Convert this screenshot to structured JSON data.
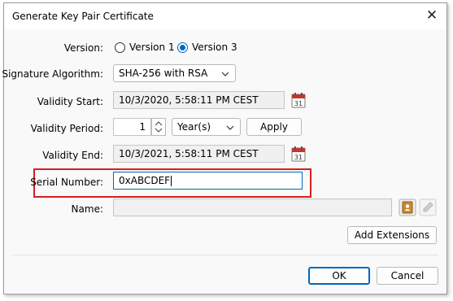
{
  "dialog": {
    "title": "Generate Key Pair Certificate",
    "close_icon": "close-icon"
  },
  "version": {
    "label": "Version:",
    "options": [
      "Version 1",
      "Version 3"
    ],
    "selected": "Version 3"
  },
  "signature": {
    "label": "Signature Algorithm:",
    "value": "SHA-256 with RSA"
  },
  "validity_start": {
    "label": "Validity Start:",
    "value": "10/3/2020, 5:58:11 PM CEST",
    "icon": "calendar-icon"
  },
  "validity_period": {
    "label": "Validity Period:",
    "value": "1",
    "unit": "Year(s)",
    "apply_label": "Apply"
  },
  "validity_end": {
    "label": "Validity End:",
    "value": "10/3/2021, 5:58:11 PM CEST",
    "icon": "calendar-icon"
  },
  "serial": {
    "label": "Serial Number:",
    "value": "0xABCDEF"
  },
  "name": {
    "label": "Name:",
    "value": "",
    "address_book_icon": "address-book-icon",
    "edit_icon": "pencil-icon"
  },
  "buttons": {
    "add_extensions": "Add Extensions",
    "ok": "OK",
    "cancel": "Cancel"
  },
  "colors": {
    "accent": "#0067c0",
    "highlight": "#d32020"
  }
}
